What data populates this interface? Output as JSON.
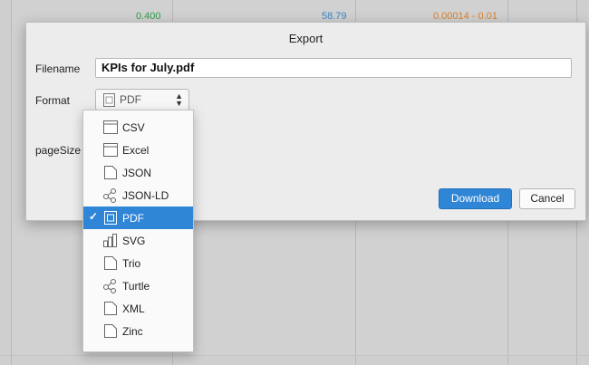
{
  "background": {
    "values": [
      "0.400",
      "58.79",
      "0.00014 - 0.01"
    ],
    "value_colors": [
      "#2e9e4a",
      "#3b86c9",
      "#d9822b"
    ]
  },
  "dialog": {
    "title": "Export",
    "filename_label": "Filename",
    "filename_value": "KPIs for July.pdf",
    "format_label": "Format",
    "format_selected": "PDF",
    "pagesize_label": "pageSize",
    "download_label": "Download",
    "cancel_label": "Cancel"
  },
  "format_menu": {
    "items": [
      {
        "label": "CSV",
        "icon": "table-icon"
      },
      {
        "label": "Excel",
        "icon": "table-icon"
      },
      {
        "label": "JSON",
        "icon": "file-icon"
      },
      {
        "label": "JSON-LD",
        "icon": "graph-icon"
      },
      {
        "label": "PDF",
        "icon": "pdf-icon",
        "selected": true
      },
      {
        "label": "SVG",
        "icon": "chart-icon"
      },
      {
        "label": "Trio",
        "icon": "file-icon"
      },
      {
        "label": "Turtle",
        "icon": "graph-icon"
      },
      {
        "label": "XML",
        "icon": "file-icon"
      },
      {
        "label": "Zinc",
        "icon": "file-icon"
      }
    ],
    "check_glyph": "✓"
  },
  "colors": {
    "accent": "#2f85d6"
  }
}
